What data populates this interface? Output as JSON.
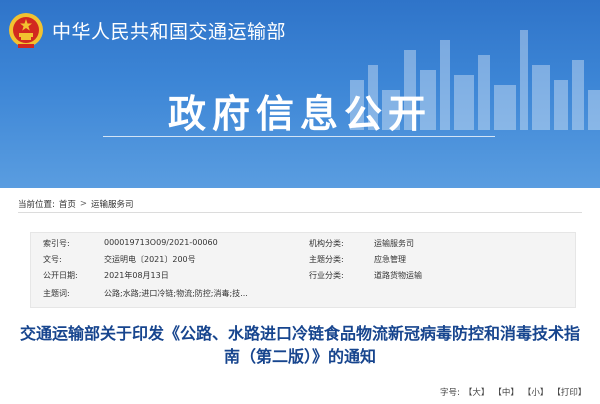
{
  "header": {
    "ministry_name": "中华人民共和国交通运输部",
    "banner_title": "政府信息公开",
    "colors": {
      "banner_top": "#2f74c9",
      "banner_bottom": "#5a9de0",
      "title_blue": "#17458e"
    },
    "emblem_icon": "national-emblem-icon"
  },
  "breadcrumb": {
    "label": "当前位置:",
    "items": [
      "首页",
      "运输服务司"
    ],
    "separator": ">"
  },
  "meta": {
    "index_label": "索引号:",
    "index_value": "000019713O09/2021-00060",
    "agency_label": "机构分类:",
    "agency_value": "运输服务司",
    "docno_label": "文号:",
    "docno_value": "交运明电〔2021〕200号",
    "topic_label": "主题分类:",
    "topic_value": "应急管理",
    "date_label": "公开日期:",
    "date_value": "2021年08月13日",
    "industry_label": "行业分类:",
    "industry_value": "道路货物运输",
    "keywords_label": "主题词:",
    "keywords_value": "公路;水路;进口冷链;物流;防控;消毒;技..."
  },
  "article": {
    "title": "交通运输部关于印发《公路、水路进口冷链食品物流新冠病毒防控和消毒技术指南（第二版）》的通知"
  },
  "font_controls": {
    "label": "字号:",
    "large": "【大】",
    "medium": "【中】",
    "small": "【小】",
    "print": "【打印】"
  }
}
